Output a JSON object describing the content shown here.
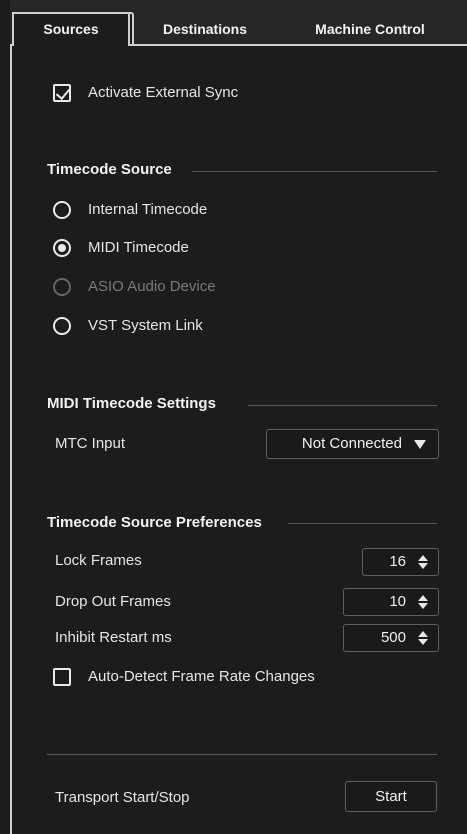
{
  "tabs": [
    {
      "label": "Sources",
      "active": true
    },
    {
      "label": "Destinations",
      "active": false
    },
    {
      "label": "Machine Control",
      "active": false
    }
  ],
  "activate_sync": {
    "label": "Activate External Sync",
    "checked": true
  },
  "timecode_source": {
    "title": "Timecode Source",
    "options": [
      {
        "label": "Internal Timecode",
        "selected": false,
        "disabled": false
      },
      {
        "label": "MIDI Timecode",
        "selected": true,
        "disabled": false
      },
      {
        "label": "ASIO Audio Device",
        "selected": false,
        "disabled": true
      },
      {
        "label": "VST System Link",
        "selected": false,
        "disabled": false
      }
    ]
  },
  "midi_settings": {
    "title": "MIDI Timecode Settings",
    "mtc_input_label": "MTC Input",
    "mtc_input_value": "Not Connected"
  },
  "preferences": {
    "title": "Timecode Source Preferences",
    "lock_frames_label": "Lock Frames",
    "lock_frames_value": "16",
    "drop_out_label": "Drop Out Frames",
    "drop_out_value": "10",
    "inhibit_label": "Inhibit Restart ms",
    "inhibit_value": "500",
    "auto_detect_label": "Auto-Detect Frame Rate Changes",
    "auto_detect_checked": false
  },
  "transport": {
    "label": "Transport Start/Stop",
    "button_label": "Start"
  }
}
